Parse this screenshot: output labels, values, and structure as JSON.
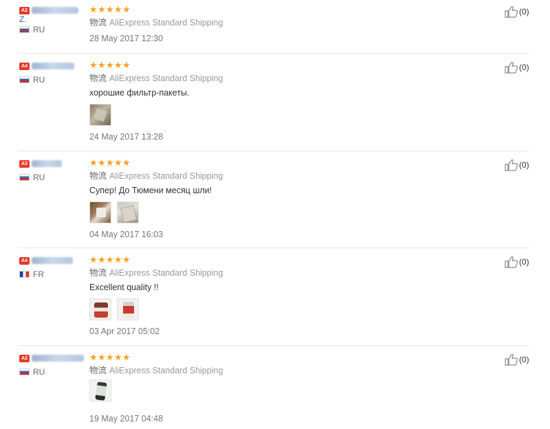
{
  "icon": "thumbs-up-icon",
  "star_color": "#f7a21b",
  "feedback": [
    {
      "level": "A2",
      "name_initial": "Z.",
      "country": "RU",
      "stars": 5,
      "shipping_label": "物流",
      "shipping": "AliExpress Standard Shipping",
      "text": "",
      "date": "28 May 2017 12:30",
      "helpful": "(0)"
    },
    {
      "level": "A4",
      "name_initial": "",
      "country": "RU",
      "stars": 5,
      "shipping_label": "物流",
      "shipping": "AliExpress Standard Shipping",
      "text": "хорошие фильтр-пакеты.",
      "date": "24 May 2017 13:28",
      "helpful": "(0)"
    },
    {
      "level": "A3",
      "name_initial": "",
      "country": "RU",
      "stars": 5,
      "shipping_label": "物流",
      "shipping": "AliExpress Standard Shipping",
      "text": "Супер! До Тюмени месяц шли!",
      "date": "04 May 2017 16:03",
      "helpful": "(0)"
    },
    {
      "level": "A4",
      "name_initial": "",
      "country": "FR",
      "stars": 5,
      "shipping_label": "物流",
      "shipping": "AliExpress Standard Shipping",
      "text": "Excellent quality !!",
      "date": "03 Apr 2017 05:02",
      "helpful": "(0)"
    },
    {
      "level": "A2",
      "name_initial": "",
      "country": "RU",
      "stars": 5,
      "shipping_label": "物流",
      "shipping": "AliExpress Standard Shipping",
      "text": "",
      "date": "19 May 2017 04:48",
      "helpful": "(0)"
    }
  ]
}
